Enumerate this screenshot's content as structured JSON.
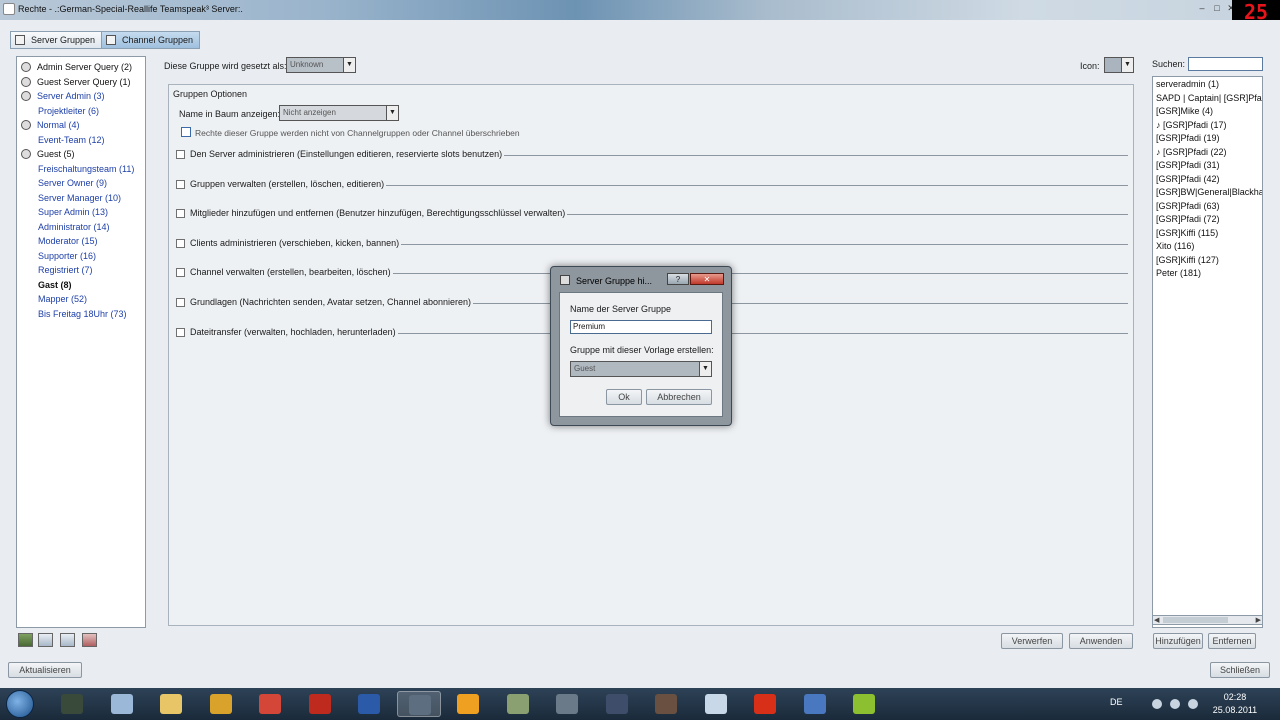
{
  "window": {
    "title": "Rechte - .:German-Special-Reallife Teamspeak³ Server:.",
    "minimize": "–",
    "maximize": "□",
    "close": "✕",
    "counter": "25"
  },
  "tabs": [
    {
      "label": "Server Gruppen",
      "icon": "server-groups-icon"
    },
    {
      "label": "Channel Gruppen",
      "icon": "channel-groups-icon"
    }
  ],
  "group_list": [
    {
      "label": "Admin Server Query (2)",
      "color": "#111111",
      "icon": true,
      "bold": false
    },
    {
      "label": "Guest Server Query (1)",
      "color": "#111111",
      "icon": true,
      "bold": false
    },
    {
      "label": "Server Admin (3)",
      "color": "#1d3fa8",
      "icon": true,
      "bold": false
    },
    {
      "label": "Projektleiter (6)",
      "color": "#1d3fa8",
      "icon": false,
      "bold": false
    },
    {
      "label": "Normal (4)",
      "color": "#1d3fa8",
      "icon": true,
      "bold": false
    },
    {
      "label": "Event-Team (12)",
      "color": "#1d3fa8",
      "icon": false,
      "bold": false
    },
    {
      "label": "Guest (5)",
      "color": "#111111",
      "icon": true,
      "bold": false
    },
    {
      "label": "Freischaltungsteam (11)",
      "color": "#1d3fa8",
      "icon": false,
      "bold": false
    },
    {
      "label": "Server Owner (9)",
      "color": "#1d3fa8",
      "icon": false,
      "bold": false
    },
    {
      "label": "Server Manager (10)",
      "color": "#1d3fa8",
      "icon": false,
      "bold": false
    },
    {
      "label": "Super Admin (13)",
      "color": "#1d3fa8",
      "icon": false,
      "bold": false
    },
    {
      "label": "Administrator (14)",
      "color": "#1d3fa8",
      "icon": false,
      "bold": false
    },
    {
      "label": "Moderator (15)",
      "color": "#1d3fa8",
      "icon": false,
      "bold": false
    },
    {
      "label": "Supporter (16)",
      "color": "#1d3fa8",
      "icon": false,
      "bold": false
    },
    {
      "label": "Registriert (7)",
      "color": "#1d3fa8",
      "icon": false,
      "bold": false
    },
    {
      "label": "Gast (8)",
      "color": "#111111",
      "icon": false,
      "bold": true
    },
    {
      "label": "Mapper (52)",
      "color": "#1d3fa8",
      "icon": false,
      "bold": false
    },
    {
      "label": "Bis Freitag 18Uhr (73)",
      "color": "#1d3fa8",
      "icon": false,
      "bold": false
    }
  ],
  "group_set_as": {
    "label": "Diese Gruppe wird gesetzt als:",
    "value": "Unknown"
  },
  "icon_selector": {
    "label": "Icon:"
  },
  "search": {
    "label": "Suchen:",
    "value": ""
  },
  "group_options": {
    "title": "Gruppen Optionen",
    "show_name_label": "Name in Baum anzeigen:",
    "show_name_value": "Nicht anzeigen",
    "override_label": "Rechte dieser Gruppe werden nicht von Channelgruppen oder Channel überschrieben"
  },
  "permissions": [
    "Den Server administrieren (Einstellungen editieren, reservierte slots benutzen)",
    "Gruppen verwalten (erstellen, löschen, editieren)",
    "Mitglieder hinzufügen und entfernen (Benutzer hinzufügen, Berechtigungsschlüssel verwalten)",
    "Clients administrieren (verschieben, kicken, bannen)",
    "Channel verwalten (erstellen, bearbeiten, löschen)",
    "Grundlagen (Nachrichten senden, Avatar setzen, Channel abonnieren)",
    "Dateitransfer (verwalten, hochladen, herunterladen)"
  ],
  "clients": [
    "serveradmin (1)",
    "SAPD | Captain| [GSR]Pfadi",
    "[GSR]Mike (4)",
    "♪ [GSR]Pfadi (17)",
    "[GSR]Pfadi (19)",
    "♪ [GSR]Pfadi (22)",
    "[GSR]Pfadi (31)",
    "[GSR]Pfadi (42)",
    "[GSR]BW|General|Blackha",
    "[GSR]Pfadi (63)",
    "[GSR]Pfadi (72)",
    "[GSR]Kiffi (115)",
    "Xito (116)",
    "[GSR]Kiffi (127)",
    "Peter (181)"
  ],
  "buttons": {
    "discard": "Verwerfen",
    "apply": "Anwenden",
    "add": "Hinzufügen",
    "remove": "Entfernen",
    "refresh": "Aktualisieren",
    "close": "Schließen"
  },
  "dialog": {
    "title": "Server Gruppe hi...",
    "help": "?",
    "close": "✕",
    "name_label": "Name der Server Gruppe",
    "name_value": "Premium",
    "template_label": "Gruppe mit dieser Vorlage erstellen:",
    "template_value": "Guest",
    "ok": "Ok",
    "cancel": "Abbrechen"
  },
  "taskbar": {
    "lang": "DE",
    "time": "02:28",
    "date": "25.08.2011",
    "apps": [
      {
        "name": "terminal-icon",
        "color": "#3a4a3a",
        "active": false
      },
      {
        "name": "app-icon",
        "color": "#9bb8d8",
        "active": false
      },
      {
        "name": "folder-icon",
        "color": "#e8c668",
        "active": false
      },
      {
        "name": "bolt-icon",
        "color": "#d9a22a",
        "active": false
      },
      {
        "name": "chrome-icon",
        "color": "#d44638",
        "active": false
      },
      {
        "name": "filezilla-icon",
        "color": "#bf2a1e",
        "active": false
      },
      {
        "name": "globe-icon",
        "color": "#2a5aa8",
        "active": false
      },
      {
        "name": "teamspeak-icon",
        "color": "#5c6e80",
        "active": true
      },
      {
        "name": "headset-icon",
        "color": "#f0a020",
        "active": false
      },
      {
        "name": "money-icon",
        "color": "#8aa070",
        "active": false
      },
      {
        "name": "tools-icon",
        "color": "#6a7a88",
        "active": false
      },
      {
        "name": "game-icon",
        "color": "#3e4d6a",
        "active": false
      },
      {
        "name": "face-icon",
        "color": "#6a5040",
        "active": false
      },
      {
        "name": "box-icon",
        "color": "#c8d8e8",
        "active": false
      },
      {
        "name": "fire-icon",
        "color": "#d83018",
        "active": false
      },
      {
        "name": "network-icon",
        "color": "#4a78c0",
        "active": false
      },
      {
        "name": "counter-icon",
        "color": "#8cc030",
        "active": false
      }
    ]
  }
}
